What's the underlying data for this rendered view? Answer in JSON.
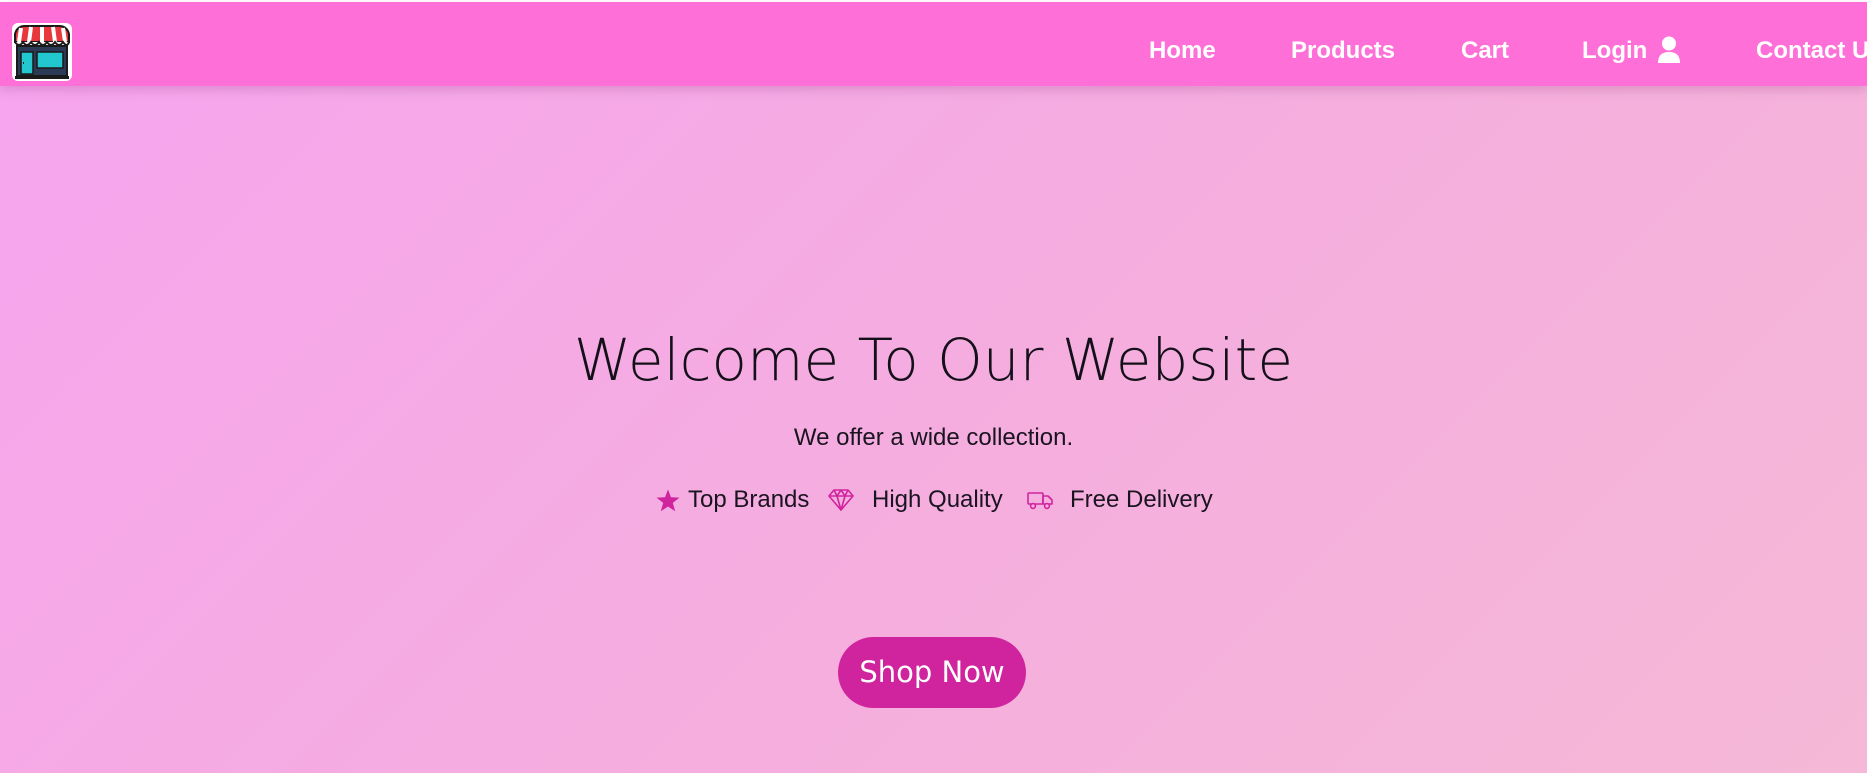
{
  "nav": {
    "home": "Home",
    "products": "Products",
    "cart": "Cart",
    "login": "Login",
    "contact": "Contact Us"
  },
  "hero": {
    "title": "Welcome To Our Website",
    "subtitle": "We offer a wide collection.",
    "features": [
      "Top Brands",
      "High Quality",
      "Free Delivery"
    ],
    "button": "Shop Now"
  },
  "icons": {
    "logo": "store-front-icon",
    "user": "user-icon",
    "feature_1": "star-icon",
    "feature_2": "diamond-icon",
    "feature_3": "truck-icon"
  },
  "colors": {
    "navbar": "#ff6fd8",
    "hero_gradient_start": "#f6a5ee",
    "hero_gradient_end": "#f5b8d6",
    "accent": "#d0249e",
    "nav_text": "#ffffff"
  }
}
